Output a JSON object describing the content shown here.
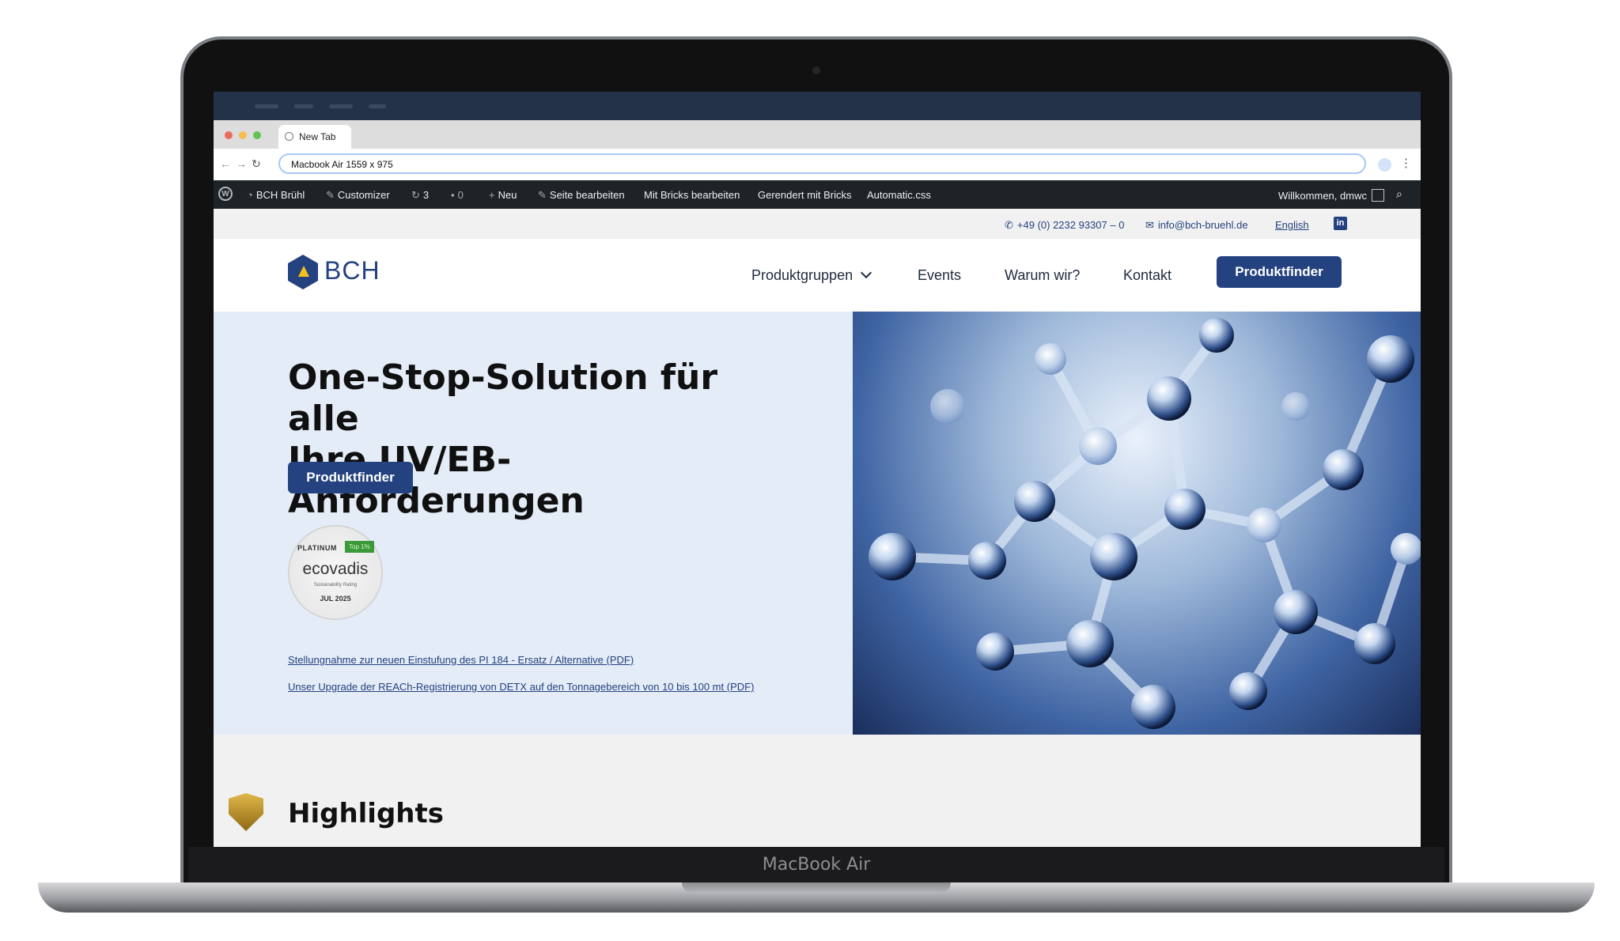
{
  "device": {
    "label": "MacBook Air"
  },
  "browser": {
    "tab_title": "New Tab",
    "url": "Macbook Air  1559 x 975"
  },
  "wp_admin_bar": {
    "site_name": "BCH Brühl",
    "customizer": "Customizer",
    "updates_count": "3",
    "comments_count": "0",
    "new": "Neu",
    "edit_page": "Seite bearbeiten",
    "edit_bricks": "Mit Bricks bearbeiten",
    "rendered_bricks": "Gerendert mit Bricks",
    "automatic_css": "Automatic.css",
    "greeting": "Willkommen, dmwc"
  },
  "top_info": {
    "phone": "+49 (0) 2232 93307 – 0",
    "email": "info@bch-bruehl.de",
    "language": "English"
  },
  "header": {
    "logo_text": "BCH",
    "nav": [
      "Produktgruppen",
      "Events",
      "Warum wir?",
      "Kontakt"
    ],
    "cta": "Produktfinder"
  },
  "hero": {
    "title_line1": "One-Stop-Solution für alle",
    "title_line2": "Ihre UV/EB-Anforderungen",
    "cta": "Produktfinder",
    "badge": {
      "level": "PLATINUM",
      "top": "Top 1%",
      "name": "ecovadis",
      "subtitle": "Sustainability Rating",
      "date": "JUL 2025"
    },
    "links": [
      "Stellungnahme zur neuen Einstufung des PI 184 - Ersatz / Alternative (PDF)",
      "Unser Upgrade der REACh-Registrierung von DETX auf den Tonnagebereich von 10 bis 100 mt (PDF)"
    ]
  },
  "highlights": {
    "title": "Highlights"
  },
  "colors": {
    "brand_blue": "#24427f",
    "hero_bg": "#e4ecf7",
    "wp_bar": "#1d2327",
    "mac_menubar": "#243249"
  },
  "icons": [
    "apple-icon",
    "globe-icon",
    "back-arrow-icon",
    "forward-arrow-icon",
    "reload-icon",
    "wordpress-icon",
    "phone-icon",
    "mail-icon",
    "linkedin-icon",
    "shield-icon"
  ]
}
